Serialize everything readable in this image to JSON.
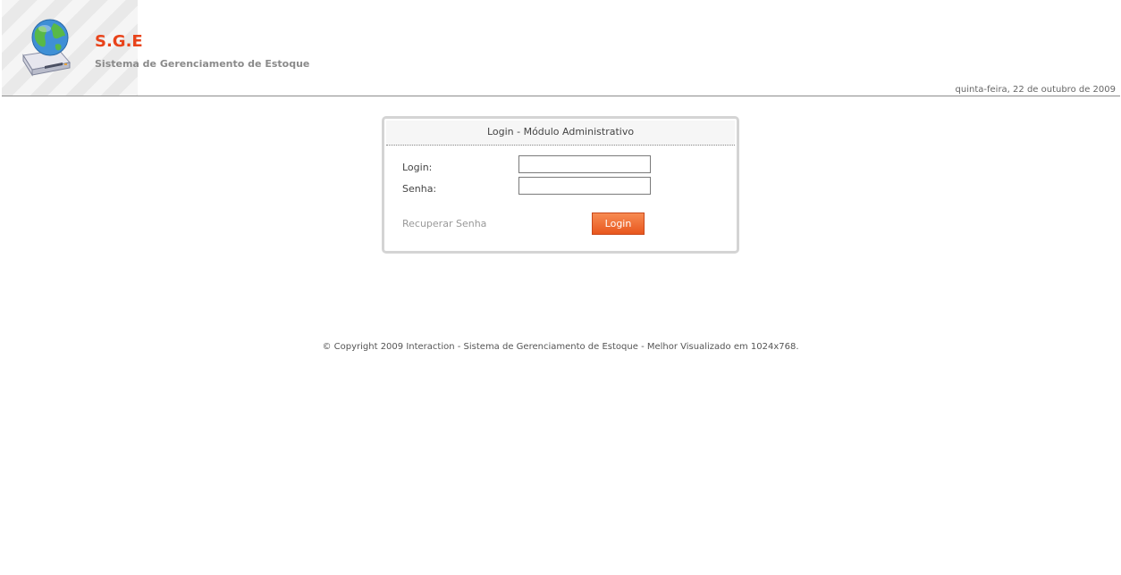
{
  "header": {
    "title": "S.G.E",
    "subtitle": "Sistema de Gerenciamento de Estoque",
    "date": "quinta-feira, 22 de outubro de 2009",
    "logo_icon": "globe-drive-icon"
  },
  "login": {
    "title": "Login - Módulo Administrativo",
    "login_label": "Login:",
    "login_value": "",
    "password_label": "Senha:",
    "password_value": "",
    "recover_label": "Recuperar Senha",
    "submit_label": "Login"
  },
  "footer": {
    "text": "© Copyright 2009 Interaction - Sistema de Gerenciamento de Estoque - Melhor Visualizado em 1024x768."
  },
  "colors": {
    "brand": "#e8431a",
    "button": "#ee6a2e"
  }
}
